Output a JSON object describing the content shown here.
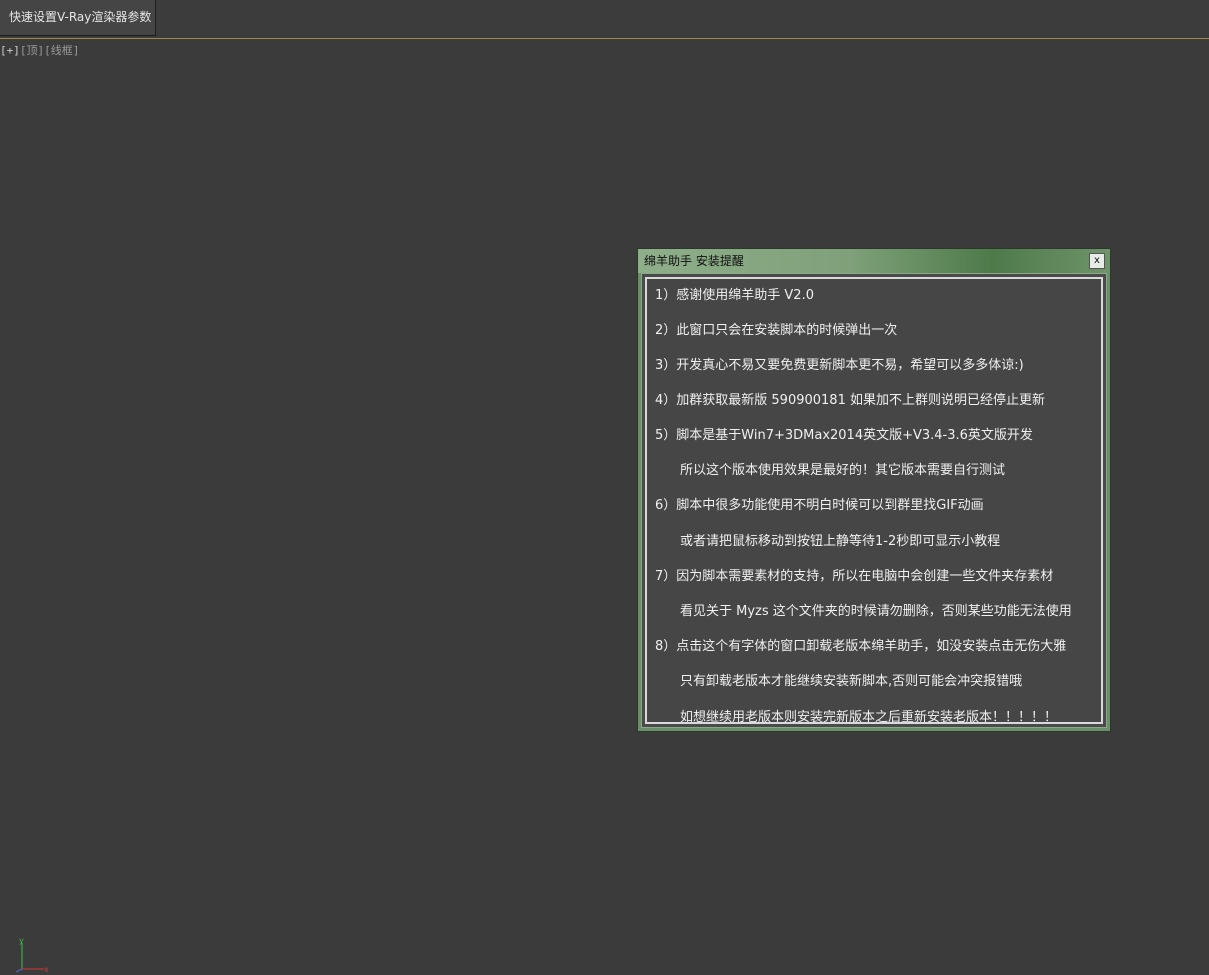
{
  "toolbar": {
    "tab_label": "快速设置V-Ray渲染器参数"
  },
  "viewport": {
    "label_plus": "[+]",
    "label_view": "[顶]",
    "label_mode": "[线框]",
    "axis_y": "y",
    "axis_x": "x"
  },
  "dialog": {
    "title": "绵羊助手 安装提醒",
    "close_label": "x",
    "lines": [
      "1）感谢使用绵羊助手 V2.0",
      "2）此窗口只会在安装脚本的时候弹出一次",
      "3）开发真心不易又要免费更新脚本更不易，希望可以多多体谅:)",
      "4）加群获取最新版    590900181   如果加不上群则说明已经停止更新",
      "5）脚本是基于Win7+3DMax2014英文版+V3.4-3.6英文版开发",
      "所以这个版本使用效果是最好的！其它版本需要自行测试",
      "6）脚本中很多功能使用不明白时候可以到群里找GIF动画",
      "或者请把鼠标移动到按钮上静等待1-2秒即可显示小教程",
      "7）因为脚本需要素材的支持，所以在电脑中会创建一些文件夹存素材",
      "看见关于 Myzs 这个文件夹的时候请勿删除，否则某些功能无法使用",
      "8）点击这个有字体的窗口卸载老版本绵羊助手，如没安装点击无伤大雅",
      "只有卸载老版本才能继续安装新脚本,否则可能会冲突报错哦",
      "如想继续用老版本则安装完新版本之后重新安装老版本！！！！！"
    ]
  },
  "colors": {
    "background": "#3b3b3b",
    "dialog_frame": "#6d8e6a",
    "accent_rule": "#a08a4a"
  }
}
